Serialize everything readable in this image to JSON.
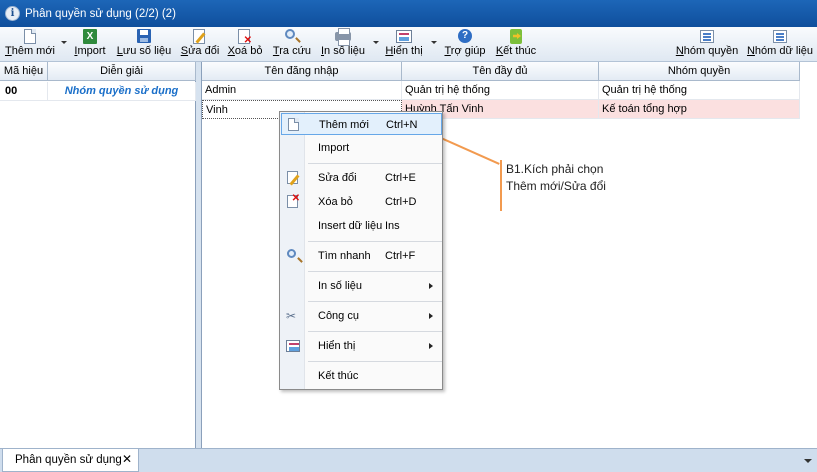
{
  "window": {
    "title": "Phân quyền sử dụng (2/2) (2)"
  },
  "toolbar": {
    "add": "Thêm mới",
    "import": "Import",
    "save": "Lưu số liệu",
    "edit": "Sửa đổi",
    "delete": "Xoá bỏ",
    "search": "Tra cứu",
    "print": "In số liệu",
    "view": "Hiển thị",
    "help": "Trợ giúp",
    "exit": "Kết thúc",
    "group_rights": "Nhóm quyền",
    "data_group": "Nhóm dữ liệu"
  },
  "left_grid": {
    "headers": [
      "Mã hiệu",
      "Diễn giải"
    ],
    "rows": [
      {
        "code": "00",
        "desc": "Nhóm quyền sử dụng"
      }
    ]
  },
  "right_grid": {
    "headers": [
      "Tên đăng nhập",
      "Tên đầy đủ",
      "Nhóm quyền"
    ],
    "rows": [
      {
        "login": "Admin",
        "fullname": "Quản trị hệ thống",
        "group": "Quản trị hệ thống"
      },
      {
        "login": "Vinh",
        "fullname": "Huỳnh Tấn Vinh",
        "group": "Kế toán tổng hợp"
      }
    ]
  },
  "context_menu": {
    "items": [
      {
        "label": "Thêm mới",
        "shortcut": "Ctrl+N",
        "icon": "new-doc-icon"
      },
      {
        "label": "Import",
        "shortcut": ""
      },
      {
        "label": "Sửa đổi",
        "shortcut": "Ctrl+E",
        "icon": "edit-icon"
      },
      {
        "label": "Xóa bỏ",
        "shortcut": "Ctrl+D",
        "icon": "delete-icon"
      },
      {
        "label": "Insert dữ liệu",
        "shortcut": "Ins"
      },
      {
        "label": "Tìm nhanh",
        "shortcut": "Ctrl+F",
        "icon": "find-icon"
      },
      {
        "label": "In số liệu",
        "shortcut": ""
      },
      {
        "label": "Công cụ",
        "shortcut": "",
        "icon": "tools-icon"
      },
      {
        "label": "Hiển thị",
        "shortcut": "",
        "icon": "view-icon"
      },
      {
        "label": "Kết thúc",
        "shortcut": ""
      }
    ]
  },
  "annotation": {
    "line1": "B1.Kích phải chọn",
    "line2": "Thêm mới/Sửa đổi"
  },
  "tabs": [
    {
      "label": "Phân quyền sử dụng",
      "close": "✕"
    }
  ],
  "colors": {
    "title_bar": "#1565b5",
    "selected_row": "#fbe0e0",
    "code_color": "#1a6fc9",
    "annotation_line": "#f29a4f"
  }
}
